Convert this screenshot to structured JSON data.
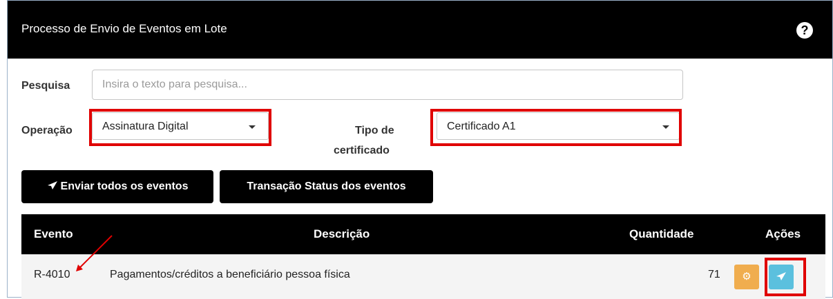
{
  "header": {
    "title": "Processo de Envio de Eventos em Lote",
    "help_icon": "?"
  },
  "search": {
    "label": "Pesquisa",
    "placeholder": "Insira o texto para pesquisa...",
    "value": ""
  },
  "operacao": {
    "label": "Operação",
    "selected": "Assinatura Digital"
  },
  "tipo_certificado": {
    "label_line1": "Tipo de",
    "label_line2": "certificado",
    "selected": "Certificado A1"
  },
  "buttons": {
    "enviar_todos": "Enviar todos os eventos",
    "transacao_status": "Transação Status dos eventos"
  },
  "table": {
    "headers": {
      "evento": "Evento",
      "descricao": "Descrição",
      "quantidade": "Quantidade",
      "acoes": "Ações"
    },
    "rows": [
      {
        "evento": "R-4010",
        "descricao": "Pagamentos/créditos a beneficiário pessoa física",
        "quantidade": "71"
      }
    ]
  },
  "colors": {
    "header_bg": "#000000",
    "highlight": "#e00000",
    "gear_button": "#f0ad4e",
    "send_button": "#5bc0de"
  },
  "icons": {
    "help": "question-circle-icon",
    "send": "paper-plane-icon",
    "gear": "gear-icon",
    "caret": "caret-down-icon"
  }
}
